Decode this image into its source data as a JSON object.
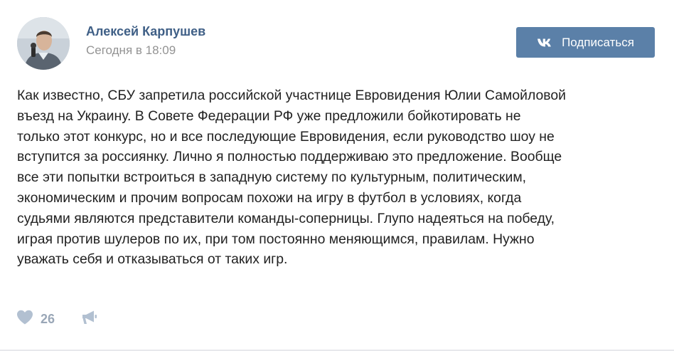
{
  "post": {
    "author": "Алексей Карпушев",
    "time": "Сегодня в 18:09",
    "text": "Как известно, СБУ запретила российской участнице Евровидения Юлии Самойловой\nвъезд на Украину. В Совете Федерации РФ уже предложили бойкотировать не\nтолько этот конкурс, но и все последующие Евровидения, если руководство шоу не\nвступится за россиянку. Лично я полностью поддерживаю это предложение. Вообще\nвсе эти попытки встроиться в западную систему по культурным, политическим,\nэкономическим и прочим вопросам похожи на игру в футбол в условиях, когда\nсудьями являются представители команды-соперницы. Глупо надеяться на победу,\nиграя против шулеров по их, при том постоянно меняющимся, правилам. Нужно\nуважать себя и отказываться от таких игр."
  },
  "subscribe": {
    "label": "Подписаться",
    "icon": "vk-logo-icon"
  },
  "footer": {
    "likes": "26",
    "like_icon": "heart-icon",
    "share_icon": "megaphone-icon"
  },
  "colors": {
    "author": "#3f5f86",
    "time": "#939393",
    "button_bg": "#5b80a8",
    "text": "#222222",
    "icon": "#b2c0d1"
  }
}
